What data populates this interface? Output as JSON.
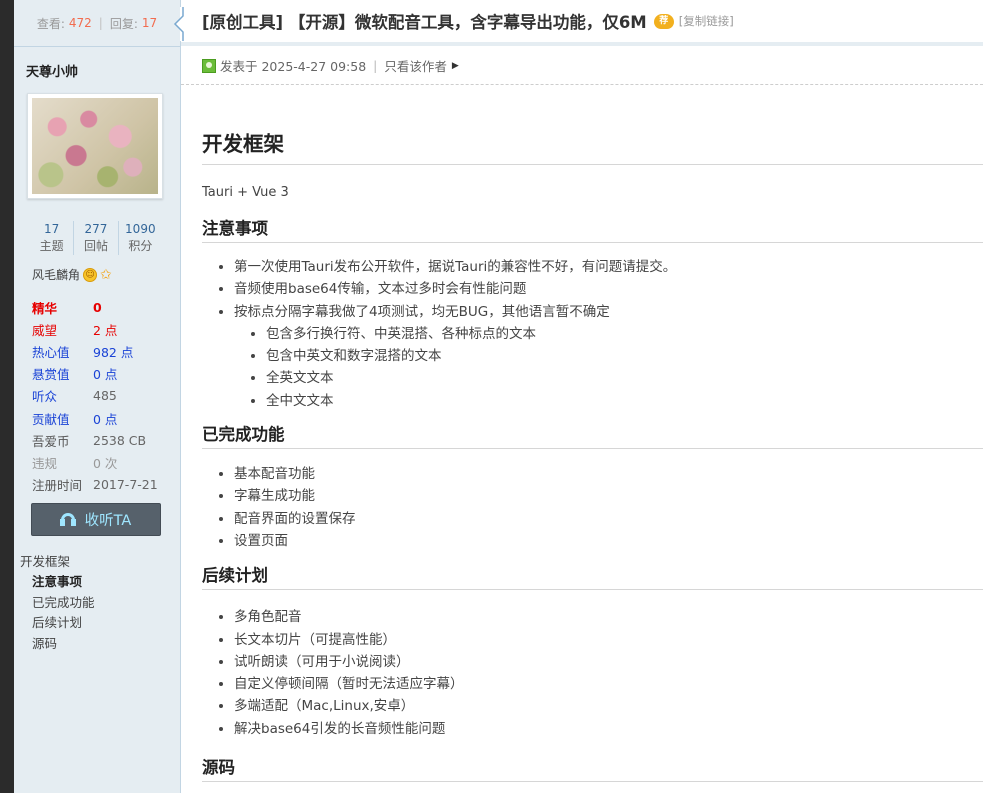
{
  "sidebar": {
    "stats": {
      "view_label": "查看:",
      "views": "472",
      "reply_label": "回复:",
      "replies": "17"
    },
    "username": "天尊小帅",
    "counts": [
      {
        "value": "17",
        "label": "主题"
      },
      {
        "value": "277",
        "label": "回帖"
      },
      {
        "value": "1090",
        "label": "积分"
      }
    ],
    "user_group": "风毛麟角",
    "props": [
      {
        "key": "精华",
        "value": "0"
      },
      {
        "key": "威望",
        "value": "2 点"
      },
      {
        "key": "热心值",
        "value": "982 点"
      },
      {
        "key": "悬赏值",
        "value": "0 点"
      },
      {
        "key": "听众",
        "value": "485"
      },
      {
        "key": "贡献值",
        "value": "0 点"
      },
      {
        "key": "吾爱币",
        "value": "2538 CB"
      },
      {
        "key": "违规",
        "value": "0 次"
      },
      {
        "key": "注册时间",
        "value": "2017-7-21"
      }
    ],
    "listen_button": "收听TA",
    "toc": {
      "root": "开发框架",
      "items": [
        "注意事项",
        "已完成功能",
        "后续计划",
        "源码"
      ]
    }
  },
  "thread": {
    "title": "[原创工具] 【开源】微软配音工具，含字幕导出功能，仅6M",
    "badge": "荐",
    "copy_link": "[复制链接]",
    "posted": "发表于 2025-4-27 09:58",
    "author_only": "只看该作者"
  },
  "content": {
    "h1": "开发框架",
    "tech": "Tauri + Vue 3",
    "notes_title": "注意事项",
    "notes": [
      "第一次使用Tauri发布公开软件，据说Tauri的兼容性不好，有问题请提交。",
      "音频使用base64传输，文本过多时会有性能问题",
      "按标点分隔字幕我做了4项测试，均无BUG，其他语言暂不确定"
    ],
    "notes_sub": [
      "包含多行换行符、中英混搭、各种标点的文本",
      "包含中英文和数字混搭的文本",
      "全英文文本",
      "全中文文本"
    ],
    "done_title": "已完成功能",
    "done": [
      "基本配音功能",
      "字幕生成功能",
      "配音界面的设置保存",
      "设置页面"
    ],
    "plan_title": "后续计划",
    "plan": [
      "多角色配音",
      "长文本切片（可提高性能）",
      "试听朗读（可用于小说阅读）",
      "自定义停顿间隔（暂时无法适应字幕）",
      "多端适配（Mac,Linux,安卓）",
      "解决base64引发的长音频性能问题"
    ],
    "source_title": "源码"
  }
}
